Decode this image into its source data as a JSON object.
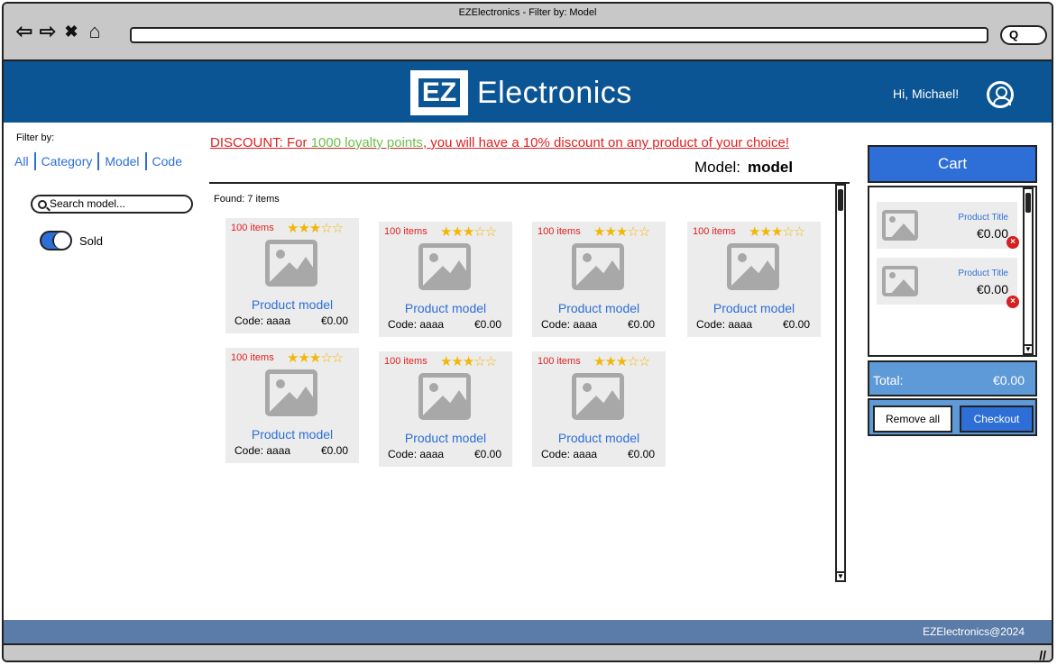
{
  "window": {
    "title": "EZElectronics - Filter by: Model",
    "nav": {
      "back": "⇦",
      "forward": "⇨",
      "close": "✖",
      "home": "⌂",
      "search_glyph": "Q"
    }
  },
  "header": {
    "logo_mark": "EZ",
    "logo_text": "Electronics",
    "greeting": "Hi, Michael!",
    "brand_color": "#0c5594"
  },
  "filter": {
    "title": "Filter by:",
    "options": [
      "All",
      "Category",
      "Model",
      "Code"
    ],
    "search_placeholder": "Search model...",
    "toggle_label": "Sold",
    "toggle_on": true
  },
  "discount": {
    "prefix": "DISCOUNT:  For ",
    "points": "1000 loyalty points",
    "suffix": ", you will have a 10% discount on any product of your choice!"
  },
  "results": {
    "heading_label": "Model:",
    "heading_value": "model",
    "found": "Found:   7 items",
    "products": [
      {
        "qty": "100 items",
        "rating": 3,
        "title": "Product model",
        "code": "Code: aaaa",
        "price": "€0.00"
      },
      {
        "qty": "100 items",
        "rating": 3,
        "title": "Product model",
        "code": "Code: aaaa",
        "price": "€0.00"
      },
      {
        "qty": "100 items",
        "rating": 3,
        "title": "Product model",
        "code": "Code: aaaa",
        "price": "€0.00"
      },
      {
        "qty": "100 items",
        "rating": 3,
        "title": "Product model",
        "code": "Code: aaaa",
        "price": "€0.00"
      },
      {
        "qty": "100 items",
        "rating": 3,
        "title": "Product model",
        "code": "Code: aaaa",
        "price": "€0.00"
      },
      {
        "qty": "100 items",
        "rating": 3,
        "title": "Product model",
        "code": "Code: aaaa",
        "price": "€0.00"
      },
      {
        "qty": "100 items",
        "rating": 3,
        "title": "Product model",
        "code": "Code: aaaa",
        "price": "€0.00"
      }
    ]
  },
  "cart": {
    "title": "Cart",
    "items": [
      {
        "title": "Product Title",
        "price": "€0.00"
      },
      {
        "title": "Product Title",
        "price": "€0.00"
      }
    ],
    "total_label": "Total:",
    "total_value": "€0.00",
    "remove_all_label": "Remove all",
    "checkout_label": "Checkout"
  },
  "footer": {
    "text": "EZElectronics@2024"
  },
  "colors": {
    "accent": "#2d6fd6",
    "discount": "#e02020",
    "loyalty": "#6cbf4a",
    "star": "#f2b705",
    "footer": "#5b7ca8"
  }
}
